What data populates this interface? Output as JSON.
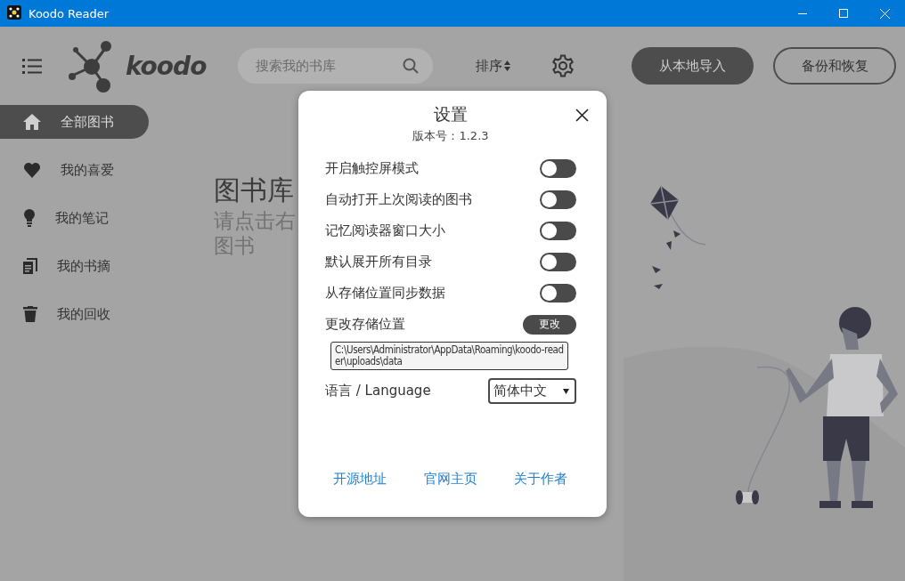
{
  "window": {
    "title": "Koodo Reader"
  },
  "header": {
    "logo_text": "koodo",
    "search": {
      "placeholder": "搜索我的书库"
    },
    "sort_label": "排序",
    "buttons": [
      {
        "label": "从本地导入",
        "kind": "filled"
      },
      {
        "label": "备份和恢复",
        "kind": "outline"
      }
    ]
  },
  "sidebar": {
    "items": [
      {
        "label": "全部图书",
        "kind": "home",
        "selected": true
      },
      {
        "label": "我的喜爱",
        "kind": "favorites",
        "selected": false
      },
      {
        "label": "我的笔记",
        "kind": "notes",
        "selected": false
      },
      {
        "label": "我的书摘",
        "kind": "digests",
        "selected": false
      },
      {
        "label": "我的回收",
        "kind": "trash",
        "selected": false
      }
    ]
  },
  "main": {
    "title": "图书库",
    "hint_lines": [
      "请点击右",
      "图书"
    ]
  },
  "settings": {
    "title": "设置",
    "version": "版本号：1.2.3",
    "toggles": [
      {
        "label": "开启触控屏模式",
        "on": false
      },
      {
        "label": "自动打开上次阅读的图书",
        "on": false
      },
      {
        "label": "记忆阅读器窗口大小",
        "on": false
      },
      {
        "label": "默认展开所有目录",
        "on": false
      },
      {
        "label": "从存储位置同步数据",
        "on": false
      }
    ],
    "storage": {
      "label": "更改存储位置",
      "button": "更改",
      "path": "C:\\Users\\Administrator\\AppData\\Roaming\\koodo-reader\\uploads\\data"
    },
    "language": {
      "label": "语言 / Language",
      "value": "简体中文"
    },
    "links": [
      "开源地址",
      "官网主页",
      "关于作者"
    ]
  }
}
